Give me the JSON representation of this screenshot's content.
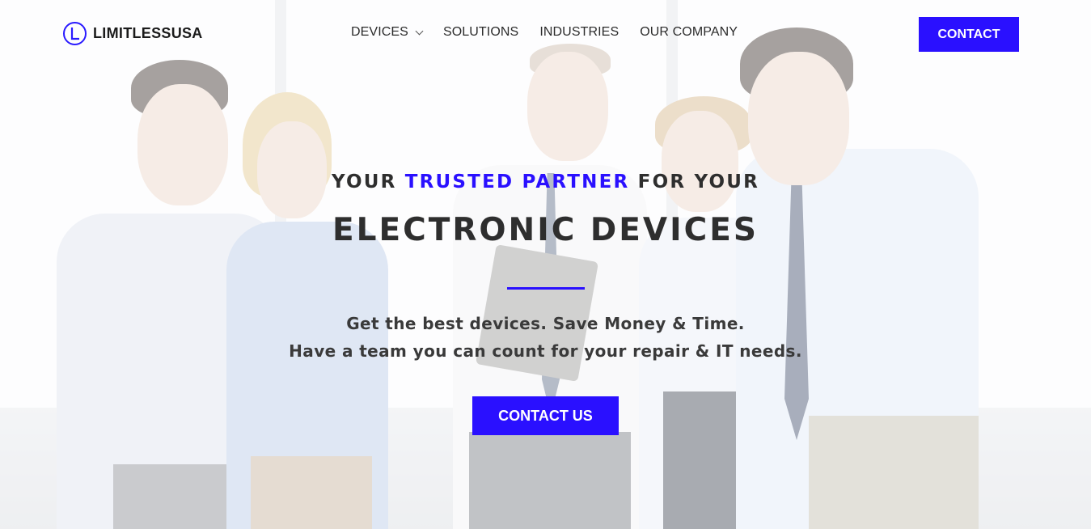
{
  "brand": {
    "name": "LIMITLESSUSA",
    "logo_icon": "letter-l-circle-icon",
    "accent_color": "#2a10ff"
  },
  "nav": {
    "items": [
      {
        "label": "DEVICES",
        "has_dropdown": true
      },
      {
        "label": "SOLUTIONS"
      },
      {
        "label": "INDUSTRIES"
      },
      {
        "label": "OUR COMPANY"
      }
    ],
    "contact_label": "CONTACT"
  },
  "hero": {
    "eyebrow_prefix": "YOUR ",
    "eyebrow_accent": "TRUSTED PARTNER",
    "eyebrow_suffix": " FOR YOUR",
    "headline": "ELECTRONIC DEVICES",
    "tagline_line1": "Get the best devices. Save Money & Time.",
    "tagline_line2": "Have a team you can count for your repair & IT needs.",
    "cta_label": "CONTACT US"
  }
}
